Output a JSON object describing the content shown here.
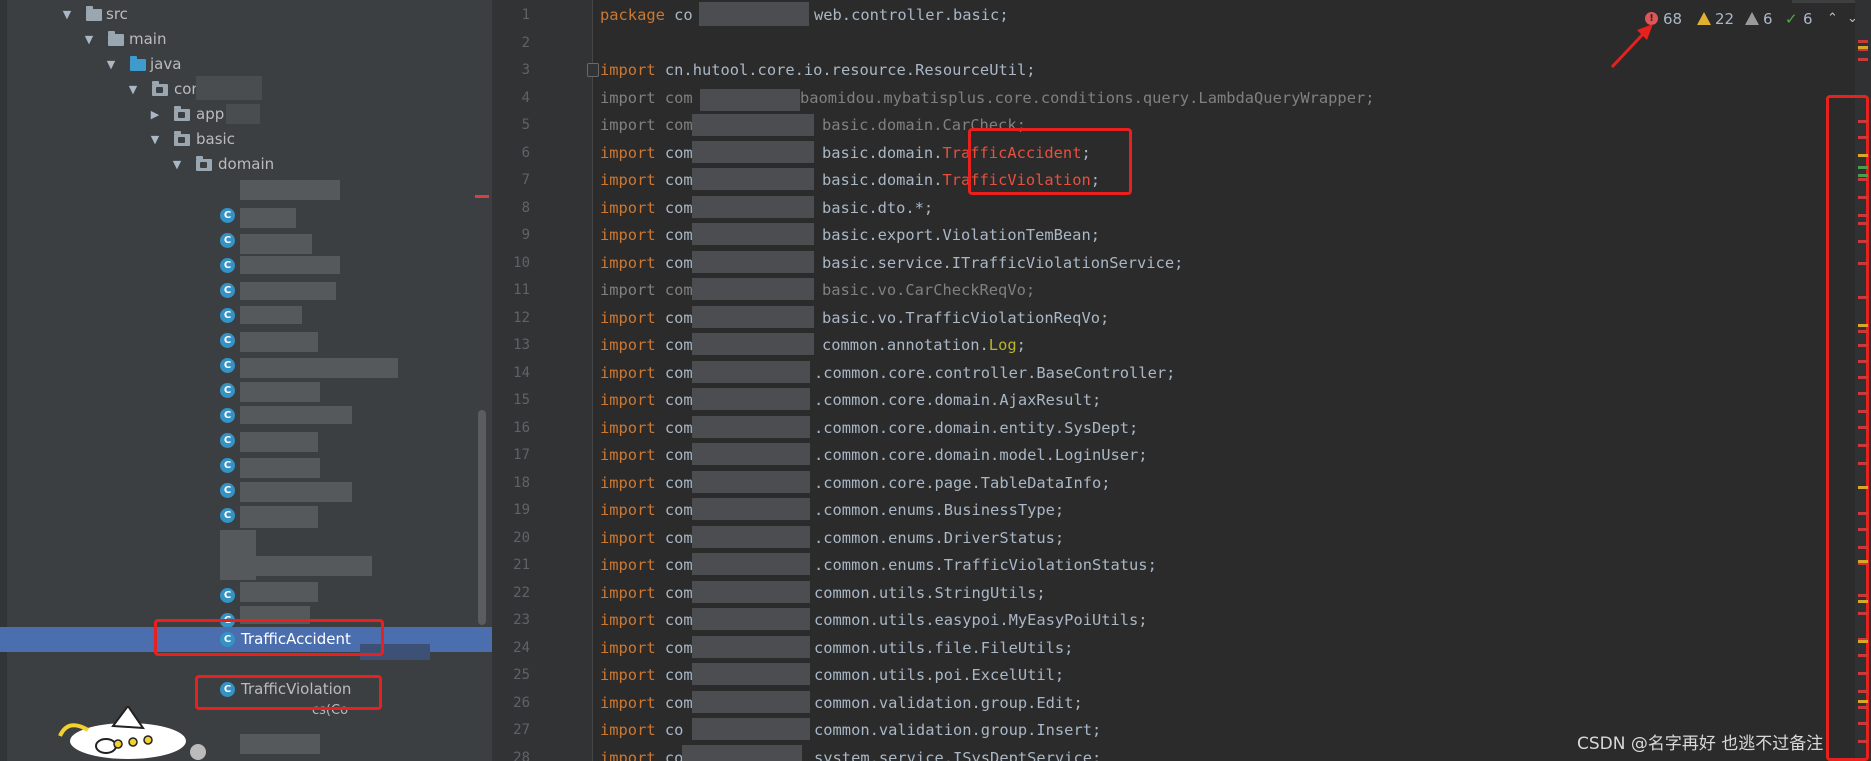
{
  "tree": {
    "rows": [
      {
        "label": "src"
      },
      {
        "label": "main"
      },
      {
        "label": "java"
      },
      {
        "label": "con"
      },
      {
        "label": "app"
      },
      {
        "label": "basic"
      },
      {
        "label": "domain"
      }
    ],
    "classes": {
      "accident": "TrafficAccident",
      "violation": "TrafficViolation",
      "partial": "cs(Co"
    },
    "class_icon": "C"
  },
  "editor": {
    "line_numbers": [
      "1",
      "2",
      "3",
      "4",
      "5",
      "6",
      "7",
      "8",
      "9",
      "10",
      "11",
      "12",
      "13",
      "14",
      "15",
      "16",
      "17",
      "18",
      "19",
      "20",
      "21",
      "22",
      "23",
      "24",
      "25",
      "26",
      "27",
      "28"
    ],
    "lines": [
      {
        "kw": "package",
        "a": "co",
        "b": "web.controller.basic;"
      },
      {
        "kw": "",
        "a": "",
        "b": ""
      },
      {
        "kw": "import",
        "a": "cn.hutool.core.io.resource.ResourceUtil;",
        "b": ""
      },
      {
        "kw": "import",
        "a": "com",
        "b": "baomidou.mybatisplus.core.conditions.query.LambdaQueryWrapper;"
      },
      {
        "kw": "import",
        "a": "com",
        "b": "basic.domain.CarCheck;"
      },
      {
        "kw": "import",
        "a": "com",
        "b": "basic.domain.",
        "c": "TrafficAccident",
        "d": ";"
      },
      {
        "kw": "import",
        "a": "com.",
        "b": "basic.domain.",
        "c": "TrafficViolation",
        "d": ";"
      },
      {
        "kw": "import",
        "a": "com.",
        "b": "basic.dto.*;"
      },
      {
        "kw": "import",
        "a": "com",
        "b": "basic.export.ViolationTemBean;"
      },
      {
        "kw": "import",
        "a": "com",
        "b": "basic.service.ITrafficViolationService;"
      },
      {
        "kw": "import",
        "a": "com",
        "b": "basic.vo.CarCheckReqVo;"
      },
      {
        "kw": "import",
        "a": "com",
        "b": "basic.vo.TrafficViolationReqVo;"
      },
      {
        "kw": "import",
        "a": "com",
        "b": "common.annotation.",
        "c": "Log",
        "d": ";"
      },
      {
        "kw": "import",
        "a": "com.",
        "b": ".common.core.controller.BaseController;"
      },
      {
        "kw": "import",
        "a": "com.",
        "b": ".common.core.domain.AjaxResult;"
      },
      {
        "kw": "import",
        "a": "com.",
        "b": ".common.core.domain.entity.SysDept;"
      },
      {
        "kw": "import",
        "a": "com.",
        "b": ".common.core.domain.model.LoginUser;"
      },
      {
        "kw": "import",
        "a": "com.",
        "b": ".common.core.page.TableDataInfo;"
      },
      {
        "kw": "import",
        "a": "com.",
        "b": ".common.enums.BusinessType;"
      },
      {
        "kw": "import",
        "a": "com.",
        "b": ".common.enums.DriverStatus;"
      },
      {
        "kw": "import",
        "a": "com.",
        "b": ".common.enums.TrafficViolationStatus;"
      },
      {
        "kw": "import",
        "a": "com",
        "b": "common.utils.StringUtils;"
      },
      {
        "kw": "import",
        "a": "com",
        "b": "common.utils.easypoi.MyEasyPoiUtils;"
      },
      {
        "kw": "import",
        "a": "com",
        "b": "common.utils.file.FileUtils;"
      },
      {
        "kw": "import",
        "a": "com",
        "b": "common.utils.poi.ExcelUtil;"
      },
      {
        "kw": "import",
        "a": "com",
        "b": "common.validation.group.Edit;"
      },
      {
        "kw": "import",
        "a": "co",
        "b": "common.validation.group.Insert;"
      },
      {
        "kw": "import",
        "a": "co",
        "b": "system.service.ISysDeptService;"
      }
    ]
  },
  "inspections": {
    "errors": "68",
    "warnings": "22",
    "weak_warnings": "6",
    "ok": "6",
    "error_glyph": "!",
    "ok_glyph": "✓",
    "up": "⌃",
    "down": "⌄"
  },
  "watermark": "CSDN @名字再好 也逃不过备注",
  "colors": {
    "annotation_red": "#e8201e",
    "selection": "#4b6eaf",
    "error_text": "#e8503e",
    "keyword": "#cc7832"
  }
}
